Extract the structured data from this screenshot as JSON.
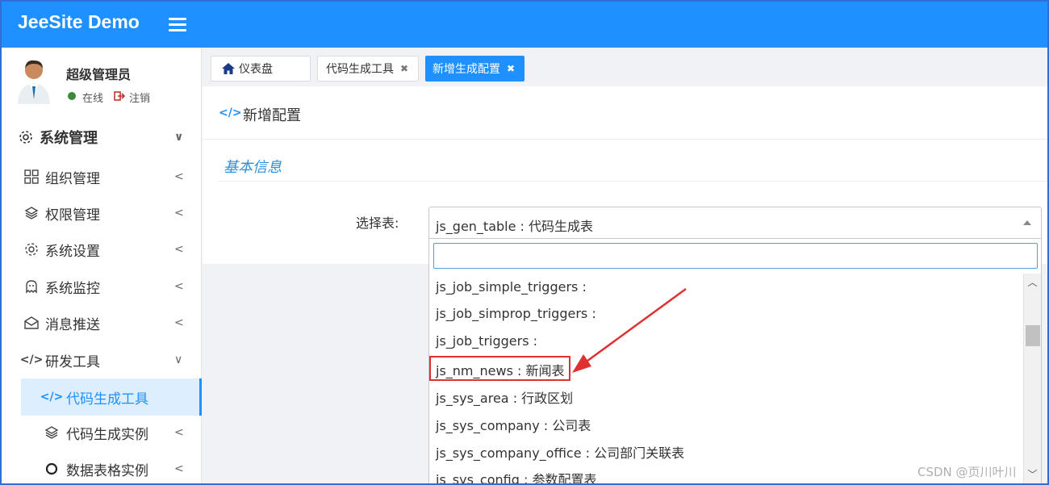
{
  "header": {
    "brand": "JeeSite Demo",
    "menu_icon": "hamburger-icon"
  },
  "user": {
    "name": "超级管理员",
    "status": "在线",
    "logout": "注销"
  },
  "sidebar": {
    "items": [
      {
        "label": "系统管理",
        "icon": "gear-icon",
        "arrow": "∨"
      },
      {
        "label": "组织管理",
        "icon": "grid-icon",
        "arrow": "<"
      },
      {
        "label": "权限管理",
        "icon": "layers-icon",
        "arrow": "<"
      },
      {
        "label": "系统设置",
        "icon": "gear-icon",
        "arrow": "<"
      },
      {
        "label": "系统监控",
        "icon": "ghost-icon",
        "arrow": "<"
      },
      {
        "label": "消息推送",
        "icon": "envelope-icon",
        "arrow": "<"
      },
      {
        "label": "研发工具",
        "icon": "code-icon",
        "arrow": "∨"
      },
      {
        "label": "代码生成工具",
        "icon": "code-icon",
        "arrow": ""
      },
      {
        "label": "代码生成实例",
        "icon": "layers-icon",
        "arrow": "<"
      },
      {
        "label": "数据表格实例",
        "icon": "circle-icon",
        "arrow": "<"
      }
    ]
  },
  "tabs": [
    {
      "label": "仪表盘",
      "icon": "home-icon"
    },
    {
      "label": "代码生成工具",
      "close": "✖"
    },
    {
      "label": "新增生成配置",
      "close": "✖"
    }
  ],
  "content": {
    "page_title": "新增配置",
    "section_title": "基本信息",
    "form_label": "选择表:",
    "select": {
      "value": "js_gen_table : 代码生成表",
      "search_value": "",
      "options": [
        "js_job_simple_triggers :",
        "js_job_simprop_triggers :",
        "js_job_triggers :",
        "js_nm_news : 新闻表",
        "js_sys_area : 行政区划",
        "js_sys_company : 公司表",
        "js_sys_company_office : 公司部门关联表",
        "js_sys_config : 参数配置表"
      ],
      "highlighted": "js_nm_news : 新闻表"
    }
  },
  "watermark": "CSDN @页川叶川",
  "colors": {
    "header": "#1e90ff",
    "accent": "#1e90ff",
    "annotation": "#e03030"
  }
}
